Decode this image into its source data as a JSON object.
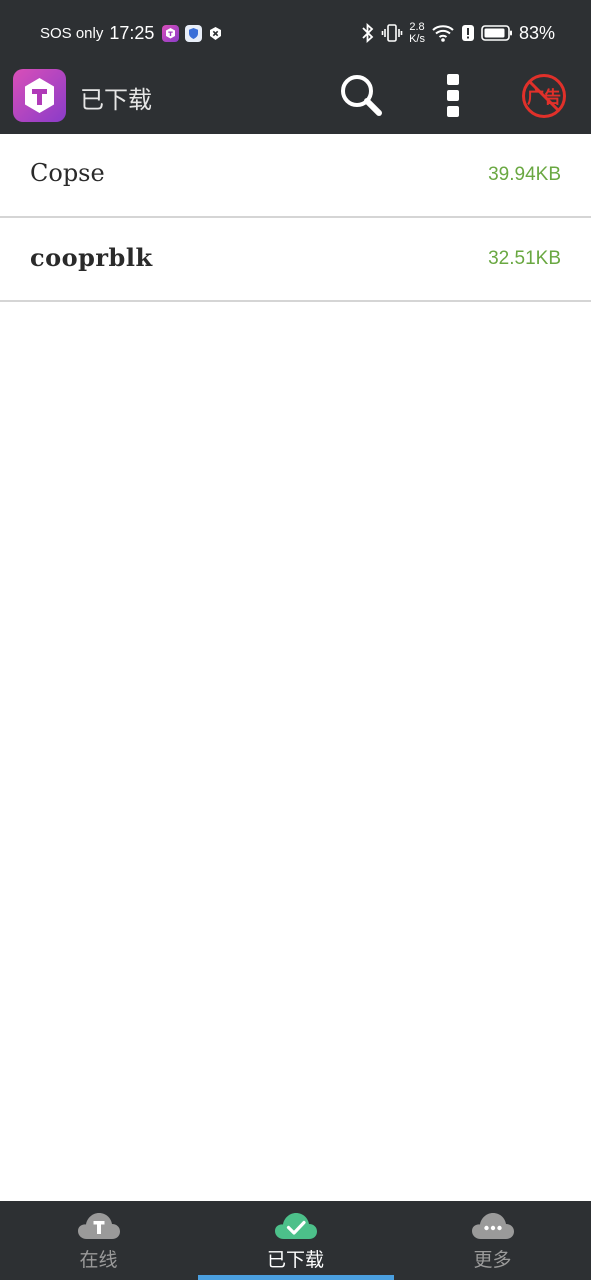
{
  "status_bar": {
    "carrier": "SOS only",
    "time": "17:25",
    "net_speed_value": "2.8",
    "net_speed_unit": "K/s",
    "battery_percent": "83%"
  },
  "toolbar": {
    "title": "已下载",
    "ads_label": "广告"
  },
  "files": [
    {
      "name": "Copse",
      "size": "39.94KB"
    },
    {
      "name": "cooprblk",
      "size": "32.51KB"
    }
  ],
  "bottom_nav": {
    "tabs": [
      {
        "label": "在线",
        "icon": "cloud-t-icon"
      },
      {
        "label": "已下载",
        "icon": "cloud-check-icon",
        "active": true
      },
      {
        "label": "更多",
        "icon": "cloud-more-icon"
      }
    ]
  },
  "colors": {
    "bar_background": "#2d3033",
    "size_text": "#6aa842",
    "active_indicator": "#4a9fe0",
    "check_cloud": "#4cc08a",
    "ads_red": "#e0302a"
  }
}
